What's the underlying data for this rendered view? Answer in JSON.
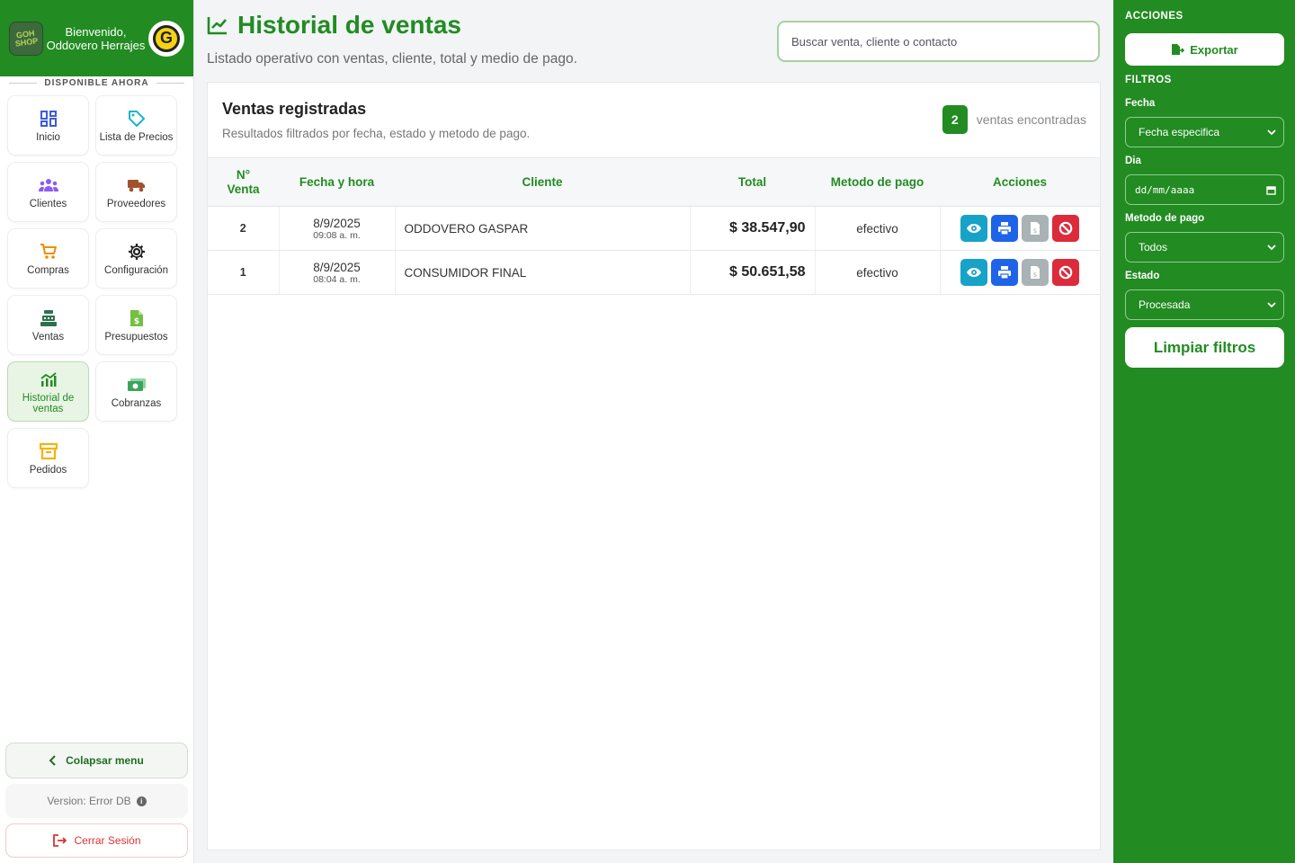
{
  "sidebar": {
    "logo_text": "GOH SHOP",
    "welcome": "Bienvenido, Oddovero Herrajes",
    "brand_logo_letter": "G",
    "section_label": "DISPONIBLE AHORA",
    "items": [
      {
        "label": "Inicio",
        "icon": "dashboard-icon",
        "color": "#3b5bdb"
      },
      {
        "label": "Lista de Precios",
        "icon": "tag-icon",
        "color": "#1cb5c9"
      },
      {
        "label": "Clientes",
        "icon": "users-icon",
        "color": "#8b5cf6"
      },
      {
        "label": "Proveedores",
        "icon": "truck-icon",
        "color": "#a0522d"
      },
      {
        "label": "Compras",
        "icon": "cart-icon",
        "color": "#f08c00"
      },
      {
        "label": "Configuración",
        "icon": "gear-icon",
        "color": "#222222"
      },
      {
        "label": "Ventas",
        "icon": "cash-register-icon",
        "color": "#2f6f4f"
      },
      {
        "label": "Presupuestos",
        "icon": "invoice-icon",
        "color": "#74c043"
      },
      {
        "label": "Historial de ventas",
        "icon": "chart-icon",
        "color": "#228b22",
        "active": true
      },
      {
        "label": "Cobranzas",
        "icon": "money-icon",
        "color": "#3ca35a"
      },
      {
        "label": "Pedidos",
        "icon": "archive-icon",
        "color": "#f5b400"
      }
    ],
    "collapse_label": "Colapsar menu",
    "version_label": "Version: Error DB",
    "logout_label": "Cerrar Sesión"
  },
  "main": {
    "title": "Historial de ventas",
    "subtitle": "Listado operativo con ventas, cliente, total y medio de pago.",
    "search_placeholder": "Buscar venta, cliente o contacto",
    "card_title": "Ventas registradas",
    "card_subtitle": "Resultados filtrados por fecha, estado y metodo de pago.",
    "count": "2",
    "count_label": "ventas encontradas",
    "columns": [
      "N° Venta",
      "Fecha y hora",
      "Cliente",
      "Total",
      "Metodo de pago",
      "Acciones"
    ],
    "rows": [
      {
        "num": "2",
        "date": "8/9/2025",
        "time": "09:08 a. m.",
        "client": "ODDOVERO GASPAR",
        "total": "$ 38.547,90",
        "method": "efectivo"
      },
      {
        "num": "1",
        "date": "8/9/2025",
        "time": "08:04 a. m.",
        "client": "CONSUMIDOR FINAL",
        "total": "$ 50.651,58",
        "method": "efectivo"
      }
    ]
  },
  "right_panel": {
    "actions_label": "ACCIONES",
    "export_label": "Exportar",
    "filters_label": "FILTROS",
    "date_label": "Fecha",
    "date_value": "Fecha especifica",
    "day_label": "Dia",
    "day_value": "dd/mm/aaaa",
    "method_label": "Metodo de pago",
    "method_value": "Todos",
    "status_label": "Estado",
    "status_value": "Procesada",
    "clear_label": "Limpiar filtros"
  },
  "colors": {
    "brand_green": "#228b22",
    "view": "#17a2c8",
    "print": "#1f63e8",
    "doc": "#a9b2b4",
    "cancel": "#dc2b3b"
  }
}
